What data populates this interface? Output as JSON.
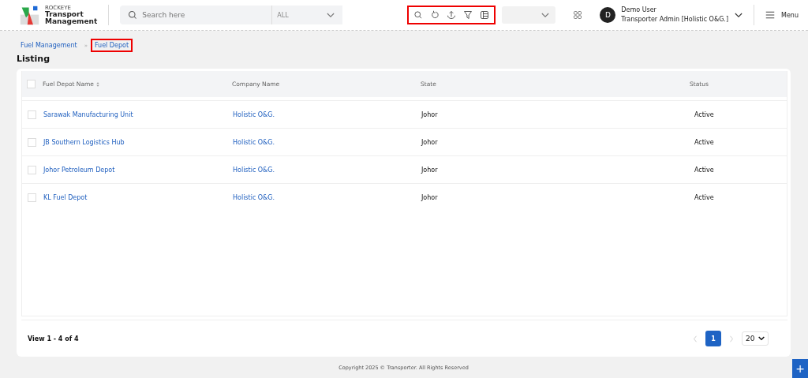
{
  "header": {
    "brand_small": "ROCKEYE",
    "brand_line1": "Transport",
    "brand_line2": "Management",
    "search": {
      "placeholder": "Search here"
    },
    "filter": {
      "value": "ALL"
    },
    "toolbar_highlighted": true,
    "user": {
      "initial": "D",
      "name": "Demo User",
      "role": "Transporter Admin [Holistic O&G.]"
    },
    "menu_label": "Menu"
  },
  "breadcrumb": [
    {
      "label": "Fuel Management",
      "highlighted": false
    },
    {
      "separator": "»",
      "label": "Fuel Depot",
      "highlighted": true
    }
  ],
  "page_title": "Listing",
  "table": {
    "header_checked": false,
    "columns": [
      {
        "label": "Fuel Depot Name",
        "sortable": true
      },
      {
        "label": "Company Name",
        "sortable": false
      },
      {
        "label": "State",
        "sortable": false
      },
      {
        "label": "Status",
        "sortable": false
      }
    ],
    "rows": [
      {
        "name": "Sarawak Manufacturing Unit",
        "company": "Holistic O&G.",
        "state": "Johor",
        "status": "Active",
        "checked": false
      },
      {
        "name": "JB Southern Logistics Hub",
        "company": "Holistic O&G.",
        "state": "Johor",
        "status": "Active",
        "checked": false
      },
      {
        "name": "Johor Petroleum Depot",
        "company": "Holistic O&G.",
        "state": "Johor",
        "status": "Active",
        "checked": false
      },
      {
        "name": "KL Fuel Depot",
        "company": "Holistic O&G.",
        "state": "Johor",
        "status": "Active",
        "checked": false
      }
    ]
  },
  "footer": {
    "summary": "View 1 - 4 of 4",
    "pages": [
      {
        "label": "1",
        "selected": true
      }
    ],
    "page_size": "20"
  },
  "copyright": "Copyright 2025 © Transporter. All Rights Reserved",
  "fab": "+"
}
